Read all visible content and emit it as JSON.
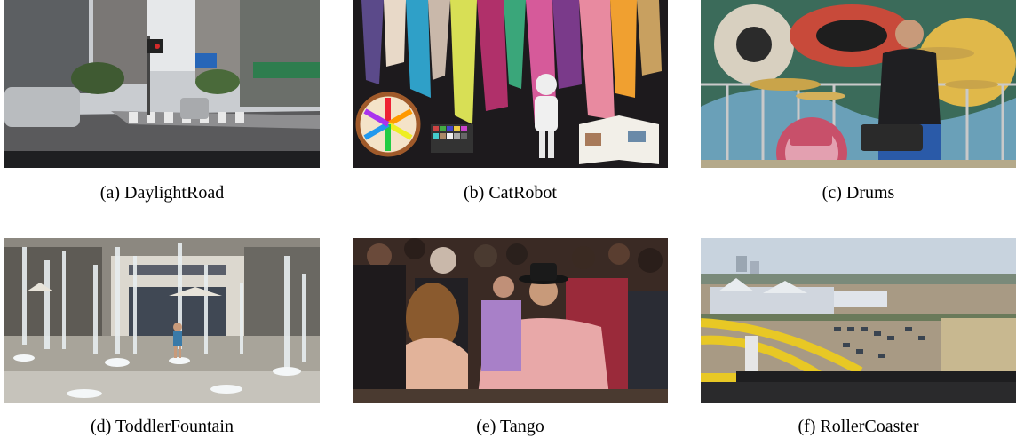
{
  "figure": {
    "panels": [
      {
        "id": "a",
        "caption": "(a) DaylightRoad",
        "icon": "street-scene"
      },
      {
        "id": "b",
        "caption": "(b) CatRobot",
        "icon": "robot-scene"
      },
      {
        "id": "c",
        "caption": "(c) Drums",
        "icon": "drummer-scene"
      },
      {
        "id": "d",
        "caption": "(d) ToddlerFountain",
        "icon": "fountain-scene"
      },
      {
        "id": "e",
        "caption": "(e) Tango",
        "icon": "dance-scene"
      },
      {
        "id": "f",
        "caption": "(f) RollerCoaster",
        "icon": "rollercoaster-scene"
      }
    ]
  }
}
